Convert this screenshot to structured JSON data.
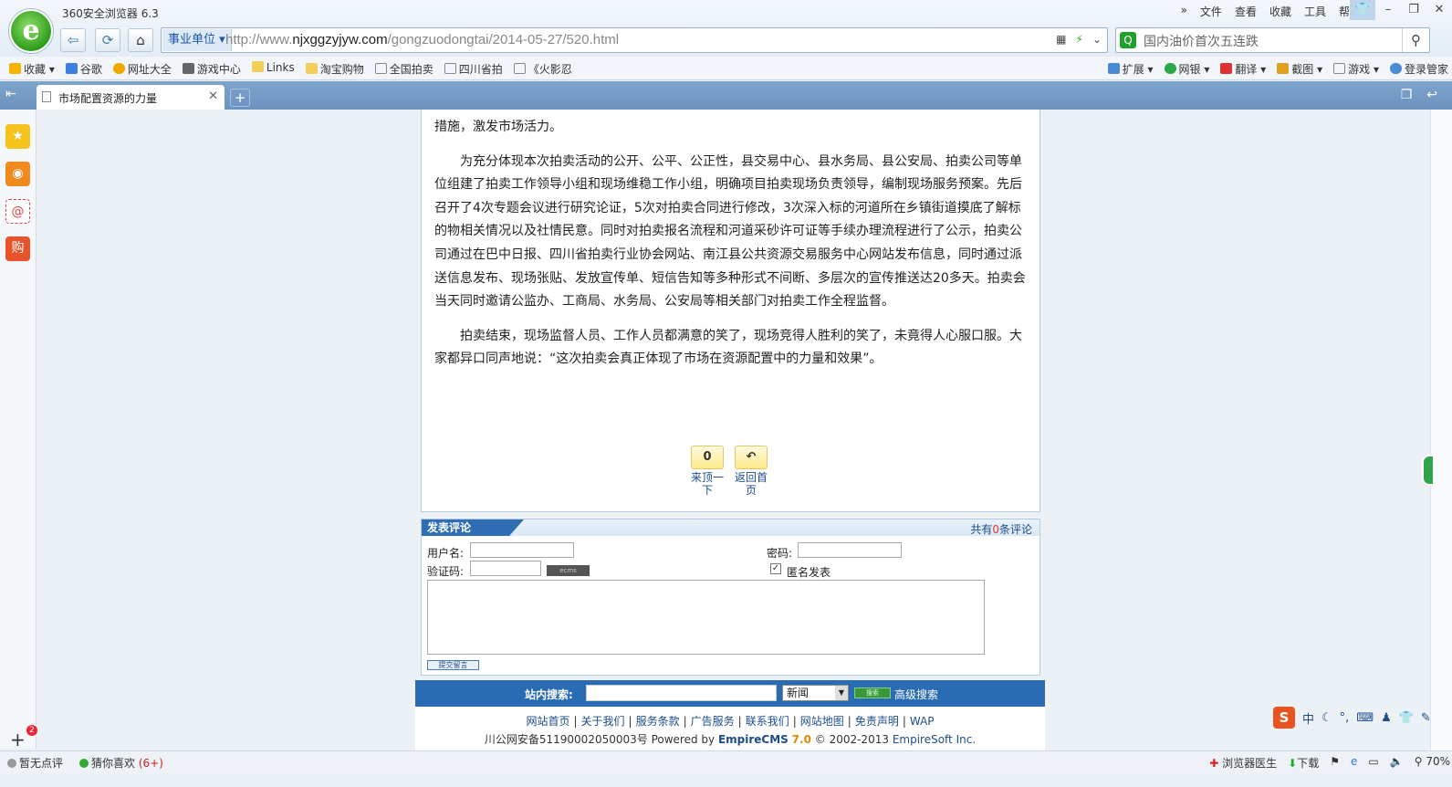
{
  "browser": {
    "title": "360安全浏览器 6.3",
    "menu": [
      "»",
      "文件",
      "查看",
      "收藏",
      "工具",
      "帮助"
    ],
    "window_controls": [
      "👕",
      "–",
      "❐",
      "✕"
    ]
  },
  "address_bar": {
    "tag": "事业单位",
    "url_prefix": "http://www.",
    "url_domain": "njxggzyjyw.com",
    "url_path": "/gongzuodongtai/2014-05-27/520.html"
  },
  "search_box": {
    "placeholder": "国内油价首次五连跌"
  },
  "bookmarks": {
    "left": [
      "收藏",
      "谷歌",
      "网址大全",
      "游戏中心",
      "Links",
      "淘宝购物",
      "全国拍卖",
      "四川省拍",
      "《火影忍"
    ],
    "right": [
      "扩展",
      "网银",
      "翻译",
      "截图",
      "游戏",
      "登录管家"
    ]
  },
  "tab": {
    "title": "市场配置资源的力量"
  },
  "article": {
    "p0": "措施，激发市场活力。",
    "p1": "为充分体现本次拍卖活动的公开、公平、公正性，县交易中心、县水务局、县公安局、拍卖公司等单位组建了拍卖工作领导小组和现场维稳工作小组，明确项目拍卖现场负责领导，编制现场服务预案。先后召开了4次专题会议进行研究论证，5次对拍卖合同进行修改，3次深入标的河道所在乡镇街道摸底了解标的物相关情况以及社情民意。同时对拍卖报名流程和河道采砂许可证等手续办理流程进行了公示，拍卖公司通过在巴中日报、四川省拍卖行业协会网站、南江县公共资源交易服务中心网站发布信息，同时通过派送信息发布、现场张贴、发放宣传单、短信告知等多种形式不间断、多层次的宣传推送达20多天。拍卖会当天同时邀请公监办、工商局、水务局、公安局等相关部门对拍卖工作全程监督。",
    "p2": "拍卖结束，现场监督人员、工作人员都满意的笑了，现场竞得人胜利的笑了，未竟得人心服口服。大家都异口同声地说：“这次拍卖会真正体现了市场在资源配置中的力量和效果”。"
  },
  "page_buttons": {
    "digg_count": "0",
    "digg_label": "来顶一下",
    "home_icon": "↶",
    "home_label": "返回首页"
  },
  "comment": {
    "title": "发表评论",
    "count_prefix": "共有",
    "count": "0",
    "count_suffix": "条评论",
    "username_label": "用户名:",
    "password_label": "密码:",
    "captcha_label": "验证码:",
    "captcha_text": "ecms",
    "anonymous_label": "匿名发表",
    "anonymous_checked": true,
    "submit_label": "提交留言"
  },
  "site_search": {
    "label": "站内搜索:",
    "select_value": "新闻",
    "go_label": "搜索",
    "advanced_label": "高级搜索"
  },
  "footer": {
    "links": [
      "网站首页",
      "关于我们",
      "服务条款",
      "广告服务",
      "联系我们",
      "网站地图",
      "免责声明",
      "WAP"
    ],
    "icp": "川公网安备51190002050003号",
    "powered_by": "Powered by",
    "cms_name": "EmpireCMS",
    "cms_version": "7.0",
    "copyright": "© 2002-2013",
    "company": "EmpireSoft Inc."
  },
  "ime": {
    "logo": "S",
    "mode": "中"
  },
  "status_bar": {
    "rating": "暂无点评",
    "guess": "猜你喜欢",
    "guess_count": "(6+)",
    "doctor": "浏览器医生",
    "download": "下载",
    "zoom": "70%"
  },
  "sidebar": {
    "badge_count": "2"
  },
  "colors": {
    "accent_blue": "#2a6cb3",
    "tab_bar": "#7ea4cc",
    "link_blue": "#1e4c8a",
    "cms_version_orange": "#e08a00"
  }
}
